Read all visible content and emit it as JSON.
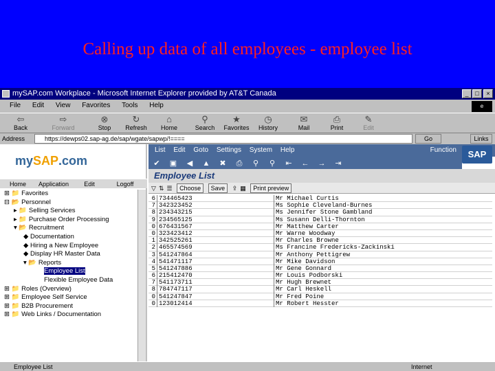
{
  "slide": {
    "title": "Calling up data of all employees - employee list"
  },
  "window": {
    "title": "mySAP.com Workplace - Microsoft Internet Explorer provided by AT&T Canada"
  },
  "menu": [
    "File",
    "Edit",
    "View",
    "Favorites",
    "Tools",
    "Help"
  ],
  "toolbar": [
    {
      "label": "Back",
      "icon": "back-arrow-icon"
    },
    {
      "label": "Forward",
      "icon": "forward-arrow-icon"
    },
    {
      "label": "Stop",
      "icon": "stop-icon"
    },
    {
      "label": "Refresh",
      "icon": "refresh-icon"
    },
    {
      "label": "Home",
      "icon": "home-icon"
    },
    {
      "label": "Search",
      "icon": "search-icon"
    },
    {
      "label": "Favorites",
      "icon": "favorites-icon"
    },
    {
      "label": "History",
      "icon": "history-icon"
    },
    {
      "label": "Mail",
      "icon": "mail-icon"
    },
    {
      "label": "Print",
      "icon": "print-icon"
    },
    {
      "label": "Edit",
      "icon": "edit-icon"
    }
  ],
  "address": {
    "label": "Address",
    "value": "https://dewps02.sap-ag.de/sap/wgate/sapwp/!====",
    "go": "Go",
    "links": "Links"
  },
  "left": {
    "logo_prefix": "my",
    "logo_brand": "SAP",
    "logo_suffix": ".com",
    "nav": [
      "Home",
      "Application",
      "Edit",
      "Logoff"
    ],
    "tree": [
      "Favorites",
      "Personnel",
      "Selling Services",
      "Purchase Order Processing",
      "Recruitment",
      "Documentation",
      "Hiring a New Employee",
      "Display HR Master Data",
      "Reports",
      "Employee List",
      "Flexible Employee Data",
      "Roles (Overview)",
      "Employee Self Service",
      "B2B Procurement",
      "Web Links / Documentation"
    ]
  },
  "sap": {
    "menu": [
      "List",
      "Edit",
      "Goto",
      "Settings",
      "System",
      "Help"
    ],
    "function": "Function",
    "logo": "SAP",
    "page_title": "Employee List",
    "app_buttons": [
      "Choose",
      "Save",
      "Print preview"
    ]
  },
  "employees": [
    {
      "n": "6",
      "id": "734465423",
      "name": "Mr Michael Curtis"
    },
    {
      "n": "7",
      "id": "342323452",
      "name": "Ms Sophie Cleveland-Burnes"
    },
    {
      "n": "8",
      "id": "234343215",
      "name": "Ms Jennifer Stone Gambland"
    },
    {
      "n": "9",
      "id": "234565125",
      "name": "Ms Susann Delli-Thornton"
    },
    {
      "n": "0",
      "id": "676431567",
      "name": "Mr Matthew Carter"
    },
    {
      "n": "0",
      "id": "323423412",
      "name": "Mr Warne Woodway"
    },
    {
      "n": "1",
      "id": "342525261",
      "name": "Mr Charles Browne"
    },
    {
      "n": "2",
      "id": "465574569",
      "name": "Ms Francine Fredericks-Zackinski"
    },
    {
      "n": "3",
      "id": "541247864",
      "name": "Mr Anthony Pettigrew"
    },
    {
      "n": "4",
      "id": "541471117",
      "name": "Mr Mike Davidson"
    },
    {
      "n": "5",
      "id": "541247886",
      "name": "Mr Gene Gonnard"
    },
    {
      "n": "6",
      "id": "215412470",
      "name": "Mr Louis Podborski"
    },
    {
      "n": "7",
      "id": "541173711",
      "name": "Mr Hugh Brewnet"
    },
    {
      "n": "8",
      "id": "784747117",
      "name": "Mr Carl Heskell"
    },
    {
      "n": "0",
      "id": "541247847",
      "name": "Mr Fred Poine"
    },
    {
      "n": "0",
      "id": "123012414",
      "name": "Mr Robert Hesster"
    }
  ],
  "status": {
    "text": "Employee List",
    "zone": "Internet"
  }
}
